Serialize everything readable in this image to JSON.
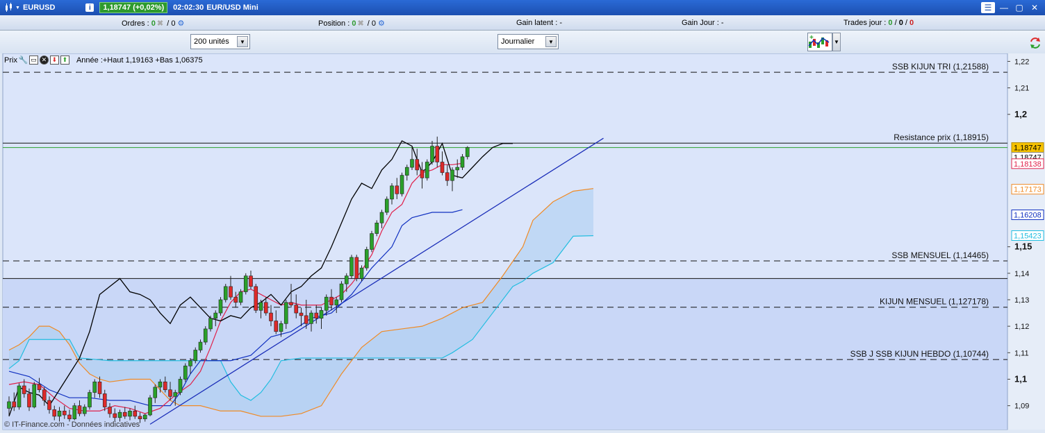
{
  "window": {
    "symbol": "EURUSD",
    "price_badge": "1,18747 (+0,02%)",
    "time": "02:02:30",
    "subtitle": "EUR/USD Mini"
  },
  "infobar": {
    "orders_label": "Ordres :",
    "orders_value": "0",
    "orders_total": "/ 0",
    "position_label": "Position :",
    "position_value": "0",
    "position_total": "/ 0",
    "latent_label": "Gain latent :",
    "latent_value": "-",
    "day_label": "Gain Jour :",
    "day_value": "-",
    "trades_label": "Trades jour :",
    "trades_v1": "0",
    "trades_v2": "0",
    "trades_v3": "0"
  },
  "toolbar": {
    "quantity": "200 unités",
    "period": "Journalier"
  },
  "panel": {
    "label": "Prix",
    "year_stats": "Année :+Haut 1,19163 +Bas 1,06375"
  },
  "watermark": "© IT-Finance.com - Données indicatives",
  "colors": {
    "bull": "#2aa02a",
    "bear": "#dd2a2a",
    "lagging": "#000000",
    "tenkan": "#e0204a",
    "kijun": "#1030c0",
    "ssa": "#f08a24",
    "ssb": "#22bde0",
    "cloud": "#a9cdf0",
    "trend": "#1a2db8",
    "last_line": "#2aa02a"
  },
  "chart_data": {
    "type": "candlestick",
    "ylim": [
      1.081,
      1.223
    ],
    "y_ticks": [
      {
        "v": 1.22,
        "label": "1,22",
        "bold": false
      },
      {
        "v": 1.21,
        "label": "1,21",
        "bold": false
      },
      {
        "v": 1.2,
        "label": "1,2",
        "bold": true
      },
      {
        "v": 1.15,
        "label": "1,15",
        "bold": true
      },
      {
        "v": 1.14,
        "label": "1,14",
        "bold": false
      },
      {
        "v": 1.13,
        "label": "1,13",
        "bold": false
      },
      {
        "v": 1.12,
        "label": "1,12",
        "bold": false
      },
      {
        "v": 1.11,
        "label": "1,11",
        "bold": false
      },
      {
        "v": 1.1,
        "label": "1,1",
        "bold": true
      },
      {
        "v": 1.09,
        "label": "1,09",
        "bold": false
      }
    ],
    "levels": [
      {
        "v": 1.21588,
        "label": "SSB KIJUN TRI (1,21588)",
        "style": "dash"
      },
      {
        "v": 1.18915,
        "label": "Resistance prix (1,18915)",
        "style": "solid"
      },
      {
        "v": 1.14465,
        "label": "SSB MENSUEL (1,14465)",
        "style": "dash"
      },
      {
        "v": 1.138,
        "label": "",
        "style": "solid"
      },
      {
        "v": 1.127178,
        "label": "KIJUN MENSUEL (1,127178)",
        "style": "dash"
      },
      {
        "v": 1.10744,
        "label": "SSB J SSB KIJUN HEBDO (1,10744)",
        "style": "dash"
      }
    ],
    "last_price": 1.18747,
    "price_badges": [
      {
        "v": 1.18747,
        "label": "1,18747",
        "bg": "#f6c200",
        "fg": "#000",
        "border": "#b08a00",
        "dy": 0
      },
      {
        "v": 1.18747,
        "label": "1,18747",
        "bg": "#ffffff",
        "fg": "#000",
        "border": "#888",
        "dy": 14
      },
      {
        "v": 1.18138,
        "label": "1,18138",
        "bg": "#ffffff",
        "fg": "#e0204a",
        "border": "#e0204a",
        "dy": 0
      },
      {
        "v": 1.17173,
        "label": "1,17173",
        "bg": "#ffffff",
        "fg": "#f08a24",
        "border": "#f08a24",
        "dy": 0
      },
      {
        "v": 1.16208,
        "label": "1,16208",
        "bg": "#ffffff",
        "fg": "#1030c0",
        "border": "#1030c0",
        "dy": 0
      },
      {
        "v": 1.15423,
        "label": "1,15423",
        "bg": "#ffffff",
        "fg": "#22bde0",
        "border": "#22bde0",
        "dy": 0
      }
    ],
    "candles": {
      "start_index": 0,
      "ohlc": [
        [
          1.089,
          1.0935,
          1.086,
          1.0915
        ],
        [
          1.0915,
          1.095,
          1.088,
          1.0895
        ],
        [
          1.0895,
          1.0985,
          1.0885,
          1.0975
        ],
        [
          1.0975,
          1.1,
          1.093,
          1.0945
        ],
        [
          1.0945,
          1.0965,
          1.088,
          1.0895
        ],
        [
          1.0895,
          1.099,
          1.089,
          1.098
        ],
        [
          1.098,
          1.1005,
          1.095,
          1.096
        ],
        [
          1.096,
          1.097,
          1.09,
          1.092
        ],
        [
          1.092,
          1.0935,
          1.087,
          1.0885
        ],
        [
          1.0885,
          1.09,
          1.0845,
          1.086
        ],
        [
          1.086,
          1.0895,
          1.084,
          1.088
        ],
        [
          1.088,
          1.09,
          1.085,
          1.0865
        ],
        [
          1.0865,
          1.0885,
          1.084,
          1.085
        ],
        [
          1.085,
          1.091,
          1.0845,
          1.09
        ],
        [
          1.09,
          1.092,
          1.086,
          1.087
        ],
        [
          1.087,
          1.0905,
          1.086,
          1.0895
        ],
        [
          1.0895,
          1.096,
          1.0885,
          1.095
        ],
        [
          1.095,
          1.1,
          1.093,
          1.099
        ],
        [
          1.099,
          1.101,
          1.093,
          1.0945
        ],
        [
          1.0945,
          1.096,
          1.088,
          1.0895
        ],
        [
          1.0895,
          1.091,
          1.0855,
          1.087
        ],
        [
          1.087,
          1.089,
          1.084,
          1.0855
        ],
        [
          1.0855,
          1.0885,
          1.084,
          1.0875
        ],
        [
          1.0875,
          1.0895,
          1.085,
          1.086
        ],
        [
          1.086,
          1.089,
          1.0845,
          1.088
        ],
        [
          1.088,
          1.09,
          1.085,
          1.086
        ],
        [
          1.086,
          1.0875,
          1.0835,
          1.085
        ],
        [
          1.085,
          1.087,
          1.084,
          1.0865
        ],
        [
          1.0865,
          1.094,
          1.086,
          1.093
        ],
        [
          1.093,
          1.098,
          1.091,
          1.097
        ],
        [
          1.097,
          1.1,
          1.095,
          1.099
        ],
        [
          1.099,
          1.101,
          1.095,
          1.096
        ],
        [
          1.096,
          1.099,
          1.092,
          1.0935
        ],
        [
          1.0935,
          1.096,
          1.09,
          1.095
        ],
        [
          1.095,
          1.101,
          1.094,
          1.1
        ],
        [
          1.1,
          1.106,
          1.099,
          1.105
        ],
        [
          1.105,
          1.108,
          1.102,
          1.107
        ],
        [
          1.107,
          1.112,
          1.106,
          1.111
        ],
        [
          1.111,
          1.115,
          1.11,
          1.114
        ],
        [
          1.114,
          1.12,
          1.113,
          1.119
        ],
        [
          1.119,
          1.124,
          1.118,
          1.123
        ],
        [
          1.123,
          1.126,
          1.12,
          1.125
        ],
        [
          1.125,
          1.131,
          1.124,
          1.13
        ],
        [
          1.13,
          1.136,
          1.129,
          1.135
        ],
        [
          1.135,
          1.139,
          1.13,
          1.131
        ],
        [
          1.131,
          1.133,
          1.127,
          1.129
        ],
        [
          1.129,
          1.134,
          1.128,
          1.133
        ],
        [
          1.133,
          1.14,
          1.132,
          1.139
        ],
        [
          1.139,
          1.141,
          1.134,
          1.135
        ],
        [
          1.135,
          1.136,
          1.125,
          1.126
        ],
        [
          1.126,
          1.13,
          1.123,
          1.129
        ],
        [
          1.129,
          1.131,
          1.124,
          1.125
        ],
        [
          1.125,
          1.128,
          1.12,
          1.122
        ],
        [
          1.122,
          1.126,
          1.117,
          1.118
        ],
        [
          1.118,
          1.122,
          1.116,
          1.121
        ],
        [
          1.121,
          1.13,
          1.119,
          1.129
        ],
        [
          1.129,
          1.136,
          1.127,
          1.128
        ],
        [
          1.128,
          1.132,
          1.123,
          1.125
        ],
        [
          1.125,
          1.127,
          1.12,
          1.124
        ],
        [
          1.124,
          1.13,
          1.119,
          1.121
        ],
        [
          1.121,
          1.126,
          1.118,
          1.125
        ],
        [
          1.125,
          1.128,
          1.121,
          1.123
        ],
        [
          1.123,
          1.127,
          1.119,
          1.126
        ],
        [
          1.126,
          1.132,
          1.124,
          1.131
        ],
        [
          1.131,
          1.134,
          1.126,
          1.128
        ],
        [
          1.128,
          1.131,
          1.125,
          1.13
        ],
        [
          1.13,
          1.137,
          1.129,
          1.136
        ],
        [
          1.136,
          1.14,
          1.133,
          1.139
        ],
        [
          1.139,
          1.147,
          1.138,
          1.146
        ],
        [
          1.146,
          1.147,
          1.137,
          1.138
        ],
        [
          1.138,
          1.143,
          1.137,
          1.142
        ],
        [
          1.142,
          1.15,
          1.141,
          1.149
        ],
        [
          1.149,
          1.156,
          1.148,
          1.155
        ],
        [
          1.155,
          1.16,
          1.154,
          1.159
        ],
        [
          1.159,
          1.164,
          1.157,
          1.163
        ],
        [
          1.163,
          1.169,
          1.162,
          1.168
        ],
        [
          1.168,
          1.174,
          1.166,
          1.173
        ],
        [
          1.173,
          1.176,
          1.168,
          1.17
        ],
        [
          1.17,
          1.178,
          1.169,
          1.177
        ],
        [
          1.177,
          1.181,
          1.175,
          1.18
        ],
        [
          1.18,
          1.188,
          1.179,
          1.183
        ],
        [
          1.183,
          1.187,
          1.177,
          1.179
        ],
        [
          1.179,
          1.182,
          1.172,
          1.176
        ],
        [
          1.176,
          1.183,
          1.175,
          1.182
        ],
        [
          1.182,
          1.19,
          1.181,
          1.188
        ],
        [
          1.188,
          1.1916,
          1.18,
          1.182
        ],
        [
          1.182,
          1.186,
          1.177,
          1.178
        ],
        [
          1.178,
          1.181,
          1.173,
          1.175
        ],
        [
          1.175,
          1.18,
          1.171,
          1.179
        ],
        [
          1.179,
          1.183,
          1.176,
          1.18
        ],
        [
          1.18,
          1.185,
          1.179,
          1.184
        ],
        [
          1.184,
          1.188,
          1.183,
          1.1875
        ]
      ]
    },
    "lagging_span": [
      [
        0,
        1.086
      ],
      [
        2,
        1.097
      ],
      [
        4,
        1.095
      ],
      [
        6,
        1.094
      ],
      [
        8,
        1.09
      ],
      [
        10,
        1.096
      ],
      [
        12,
        1.102
      ],
      [
        14,
        1.108
      ],
      [
        16,
        1.118
      ],
      [
        18,
        1.132
      ],
      [
        20,
        1.135
      ],
      [
        22,
        1.138
      ],
      [
        24,
        1.133
      ],
      [
        26,
        1.132
      ],
      [
        28,
        1.13
      ],
      [
        30,
        1.125
      ],
      [
        32,
        1.121
      ],
      [
        34,
        1.128
      ],
      [
        36,
        1.131
      ],
      [
        38,
        1.127
      ],
      [
        40,
        1.123
      ],
      [
        42,
        1.122
      ],
      [
        44,
        1.124
      ],
      [
        46,
        1.123
      ],
      [
        48,
        1.127
      ],
      [
        50,
        1.129
      ],
      [
        52,
        1.132
      ],
      [
        54,
        1.128
      ],
      [
        56,
        1.133
      ],
      [
        58,
        1.135
      ],
      [
        60,
        1.139
      ],
      [
        62,
        1.142
      ],
      [
        64,
        1.15
      ],
      [
        66,
        1.159
      ],
      [
        68,
        1.168
      ],
      [
        70,
        1.174
      ],
      [
        72,
        1.172
      ],
      [
        74,
        1.179
      ],
      [
        76,
        1.183
      ],
      [
        78,
        1.19
      ],
      [
        80,
        1.188
      ],
      [
        82,
        1.178
      ],
      [
        84,
        1.182
      ],
      [
        86,
        1.189
      ],
      [
        88,
        1.177
      ],
      [
        90,
        1.176
      ],
      [
        92,
        1.18
      ],
      [
        94,
        1.184
      ],
      [
        96,
        1.1875
      ],
      [
        98,
        1.189
      ],
      [
        100,
        1.189
      ]
    ],
    "tenkan": [
      [
        0,
        1.098
      ],
      [
        3,
        1.099
      ],
      [
        6,
        1.098
      ],
      [
        9,
        1.093
      ],
      [
        12,
        1.089
      ],
      [
        15,
        1.088
      ],
      [
        18,
        1.088
      ],
      [
        21,
        1.09
      ],
      [
        24,
        1.089
      ],
      [
        27,
        1.087
      ],
      [
        30,
        1.089
      ],
      [
        33,
        1.094
      ],
      [
        36,
        1.098
      ],
      [
        38,
        1.103
      ],
      [
        40,
        1.112
      ],
      [
        42,
        1.122
      ],
      [
        44,
        1.129
      ],
      [
        46,
        1.133
      ],
      [
        48,
        1.134
      ],
      [
        50,
        1.132
      ],
      [
        52,
        1.13
      ],
      [
        54,
        1.128
      ],
      [
        56,
        1.129
      ],
      [
        58,
        1.128
      ],
      [
        60,
        1.128
      ],
      [
        62,
        1.128
      ],
      [
        64,
        1.13
      ],
      [
        66,
        1.132
      ],
      [
        68,
        1.136
      ],
      [
        70,
        1.141
      ],
      [
        72,
        1.147
      ],
      [
        74,
        1.156
      ],
      [
        76,
        1.163
      ],
      [
        78,
        1.166
      ],
      [
        80,
        1.174
      ],
      [
        82,
        1.178
      ],
      [
        84,
        1.179
      ],
      [
        86,
        1.181
      ],
      [
        88,
        1.181
      ],
      [
        90,
        1.1815
      ]
    ],
    "kijun": [
      [
        0,
        1.103
      ],
      [
        4,
        1.101
      ],
      [
        8,
        1.096
      ],
      [
        12,
        1.093
      ],
      [
        16,
        1.093
      ],
      [
        20,
        1.092
      ],
      [
        24,
        1.092
      ],
      [
        28,
        1.09
      ],
      [
        32,
        1.09
      ],
      [
        34,
        1.095
      ],
      [
        36,
        1.102
      ],
      [
        38,
        1.107
      ],
      [
        40,
        1.107
      ],
      [
        44,
        1.107
      ],
      [
        48,
        1.109
      ],
      [
        52,
        1.116
      ],
      [
        56,
        1.118
      ],
      [
        60,
        1.123
      ],
      [
        64,
        1.125
      ],
      [
        68,
        1.132
      ],
      [
        72,
        1.142
      ],
      [
        76,
        1.15
      ],
      [
        78,
        1.158
      ],
      [
        80,
        1.161
      ],
      [
        84,
        1.163
      ],
      [
        88,
        1.163
      ],
      [
        90,
        1.164
      ]
    ],
    "ssa": [
      [
        0,
        1.111
      ],
      [
        2,
        1.113
      ],
      [
        4,
        1.116
      ],
      [
        6,
        1.12
      ],
      [
        8,
        1.12
      ],
      [
        10,
        1.118
      ],
      [
        12,
        1.113
      ],
      [
        14,
        1.106
      ],
      [
        16,
        1.102
      ],
      [
        18,
        1.1
      ],
      [
        20,
        1.099
      ],
      [
        24,
        1.1
      ],
      [
        28,
        1.1
      ],
      [
        30,
        1.096
      ],
      [
        32,
        1.092
      ],
      [
        34,
        1.09
      ],
      [
        38,
        1.09
      ],
      [
        42,
        1.088
      ],
      [
        46,
        1.088
      ],
      [
        50,
        1.086
      ],
      [
        54,
        1.086
      ],
      [
        58,
        1.087
      ],
      [
        62,
        1.09
      ],
      [
        66,
        1.102
      ],
      [
        70,
        1.112
      ],
      [
        74,
        1.118
      ],
      [
        78,
        1.119
      ],
      [
        82,
        1.12
      ],
      [
        86,
        1.123
      ],
      [
        90,
        1.127
      ],
      [
        94,
        1.129
      ],
      [
        98,
        1.139
      ],
      [
        102,
        1.15
      ],
      [
        104,
        1.16
      ],
      [
        108,
        1.167
      ],
      [
        112,
        1.171
      ],
      [
        116,
        1.172
      ]
    ],
    "ssb": [
      [
        0,
        1.104
      ],
      [
        2,
        1.107
      ],
      [
        4,
        1.115
      ],
      [
        8,
        1.115
      ],
      [
        12,
        1.115
      ],
      [
        14,
        1.108
      ],
      [
        20,
        1.107
      ],
      [
        26,
        1.107
      ],
      [
        30,
        1.107
      ],
      [
        38,
        1.107
      ],
      [
        42,
        1.107
      ],
      [
        44,
        1.099
      ],
      [
        46,
        1.094
      ],
      [
        48,
        1.092
      ],
      [
        50,
        1.095
      ],
      [
        52,
        1.1
      ],
      [
        54,
        1.107
      ],
      [
        58,
        1.108
      ],
      [
        66,
        1.108
      ],
      [
        78,
        1.108
      ],
      [
        86,
        1.108
      ],
      [
        88,
        1.11
      ],
      [
        92,
        1.115
      ],
      [
        96,
        1.125
      ],
      [
        100,
        1.135
      ],
      [
        102,
        1.137
      ],
      [
        104,
        1.14
      ],
      [
        108,
        1.144
      ],
      [
        112,
        1.154
      ],
      [
        116,
        1.1542
      ]
    ],
    "trendline": [
      [
        28,
        1.083
      ],
      [
        118,
        1.191
      ]
    ]
  }
}
